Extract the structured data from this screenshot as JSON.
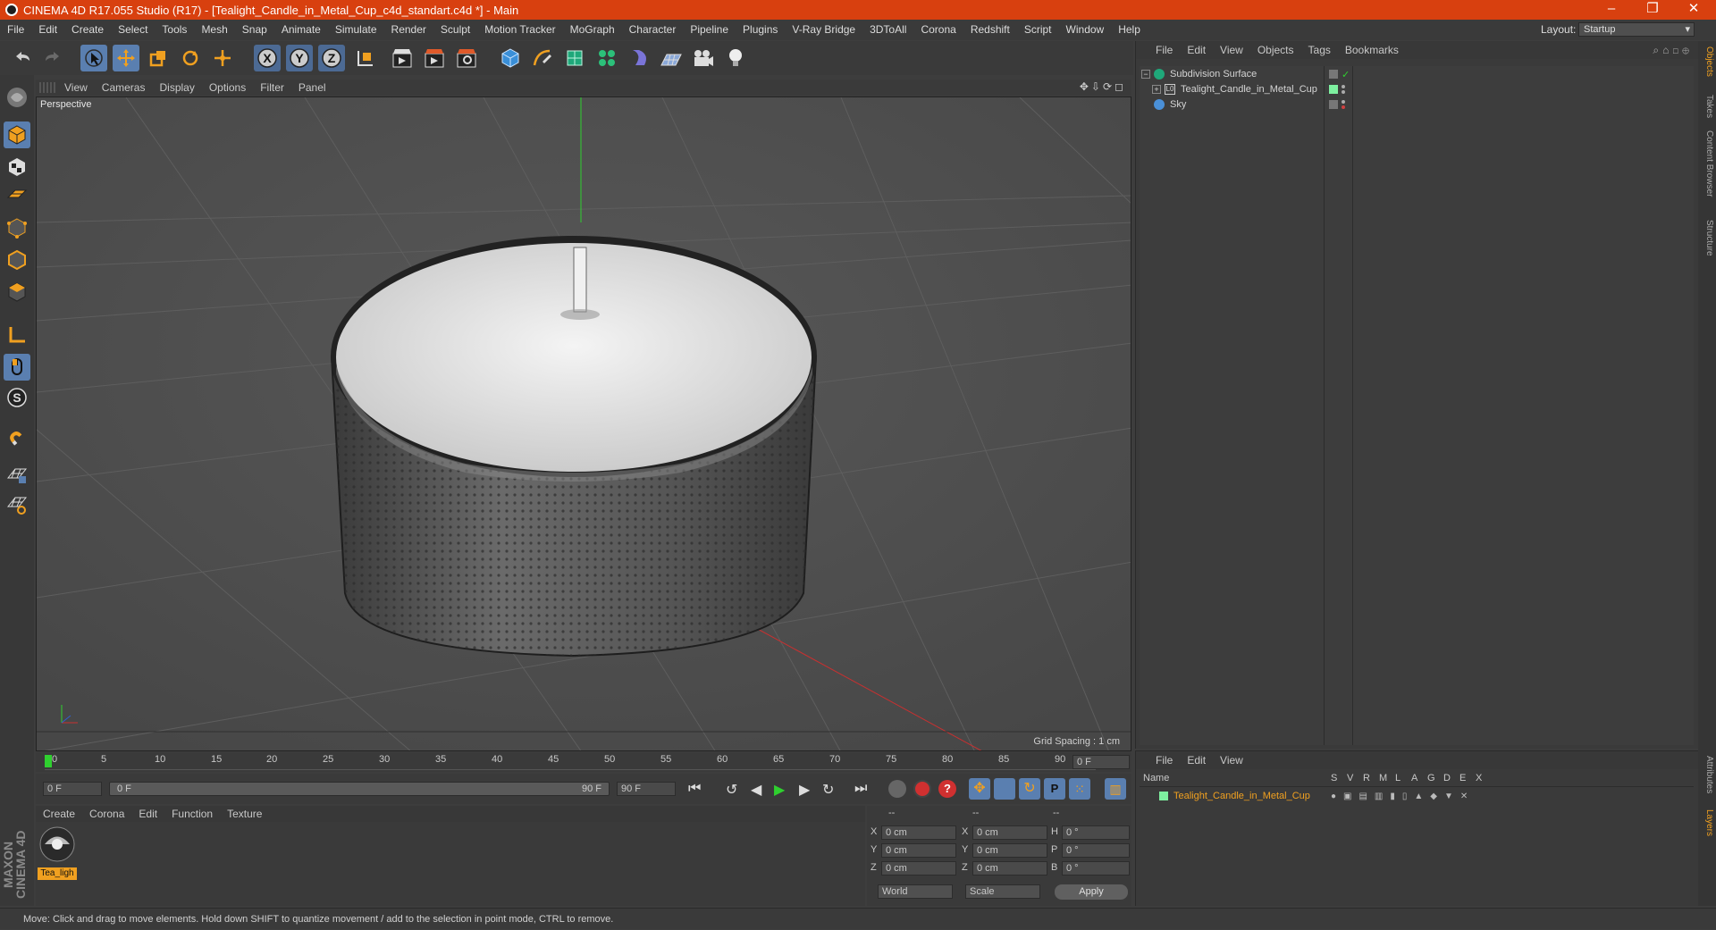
{
  "window": {
    "title": "CINEMA 4D R17.055 Studio (R17) - [Tealight_Candle_in_Metal_Cup_c4d_standart.c4d *] - Main",
    "controls": [
      "–",
      "❐",
      "✕"
    ]
  },
  "menubar": {
    "items": [
      "File",
      "Edit",
      "Create",
      "Select",
      "Tools",
      "Mesh",
      "Snap",
      "Animate",
      "Simulate",
      "Render",
      "Sculpt",
      "Motion Tracker",
      "MoGraph",
      "Character",
      "Pipeline",
      "Plugins",
      "V-Ray Bridge",
      "3DToAll",
      "Corona",
      "Redshift",
      "Script",
      "Window",
      "Help"
    ],
    "layout_label": "Layout:",
    "layout_value": "Startup"
  },
  "toolbar": {
    "icons": [
      "undo-icon",
      "redo-icon",
      "select-arrow-icon",
      "move-icon",
      "scale-icon",
      "rotate-icon",
      "live-transform-icon",
      "x-axis-icon",
      "y-axis-icon",
      "z-axis-icon",
      "coordinate-system-icon",
      "render-view-icon",
      "render-picture-viewer-icon",
      "render-settings-icon",
      "cube-icon",
      "pen-icon",
      "subdivision-icon",
      "cloner-icon",
      "deformer-icon",
      "floor-icon",
      "camera-icon",
      "light-icon"
    ],
    "axis_labels": [
      "X",
      "Y",
      "Z"
    ]
  },
  "viewport": {
    "menu": [
      "View",
      "Cameras",
      "Display",
      "Options",
      "Filter",
      "Panel"
    ],
    "label": "Perspective",
    "grid_spacing": "Grid Spacing : 1 cm"
  },
  "timeline": {
    "ticks": [
      "0",
      "5",
      "10",
      "15",
      "20",
      "25",
      "30",
      "35",
      "40",
      "45",
      "50",
      "55",
      "60",
      "65",
      "70",
      "75",
      "80",
      "85",
      "90"
    ],
    "current_frame": "0 F",
    "start_field": "0 F",
    "range_start": "0 F",
    "range_end": "90 F",
    "end_field": "90 F"
  },
  "material_manager": {
    "menu": [
      "Create",
      "Corona",
      "Edit",
      "Function",
      "Texture"
    ],
    "material_name": "Tea_ligh"
  },
  "coordinates": {
    "headers": [
      "--",
      "--",
      "--"
    ],
    "rows": [
      {
        "a": "X",
        "av": "0 cm",
        "b": "X",
        "bv": "0 cm",
        "c": "H",
        "cv": "0 °"
      },
      {
        "a": "Y",
        "av": "0 cm",
        "b": "Y",
        "bv": "0 cm",
        "c": "P",
        "cv": "0 °"
      },
      {
        "a": "Z",
        "av": "0 cm",
        "b": "Z",
        "bv": "0 cm",
        "c": "B",
        "cv": "0 °"
      }
    ],
    "mode1": "World",
    "mode2": "Scale",
    "apply": "Apply"
  },
  "object_manager": {
    "menu": [
      "File",
      "Edit",
      "View",
      "Objects",
      "Tags",
      "Bookmarks"
    ],
    "objects": [
      {
        "name": "Subdivision Surface",
        "indent": 0,
        "dot": "#7ecf7e"
      },
      {
        "name": "Tealight_Candle_in_Metal_Cup",
        "indent": 1,
        "dot": "#7ecf7e"
      },
      {
        "name": "Sky",
        "indent": 0,
        "dot": "#7ecf7e"
      }
    ]
  },
  "layer_manager": {
    "menu": [
      "File",
      "Edit",
      "View"
    ],
    "name_header": "Name",
    "columns": [
      "S",
      "V",
      "R",
      "M",
      "L",
      "A",
      "G",
      "D",
      "E",
      "X"
    ],
    "layer_name": "Tealight_Candle_in_Metal_Cup"
  },
  "side_tabs": [
    "Objects",
    "Takes",
    "Content Browser",
    "Structure"
  ],
  "side_tabs_bottom": [
    "Attributes",
    "Layers"
  ],
  "status": "Move: Click and drag to move elements. Hold down SHIFT to quantize movement / add to the selection in point mode, CTRL to remove.",
  "brand": "MAXON CINEMA 4D",
  "colors": {
    "title_bar": "#d8400f",
    "accent_selection": "#5a7fb0",
    "highlight_orange": "#f0a020"
  }
}
